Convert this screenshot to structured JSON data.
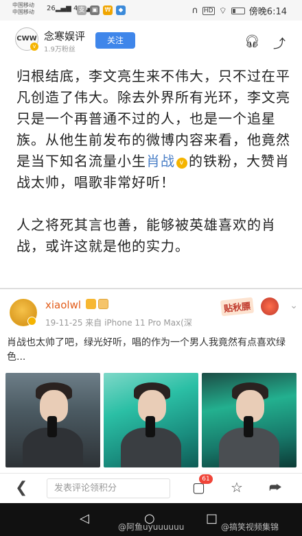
{
  "status_bar": {
    "carrier_1": "中国移动",
    "carrier_2": "中国移动",
    "net_1": "26",
    "net_2": "46",
    "time": "傍晚6:14",
    "hd_label": "HD"
  },
  "account": {
    "avatar_text": "CWW",
    "name": "念寒娱评",
    "fans": "1.9万粉丝",
    "follow_label": "关注",
    "icons": [
      "headphones-icon",
      "share-icon"
    ]
  },
  "article": {
    "para1_part1": "归根结底，李文亮生来不伟大，只不过在平凡创造了伟大。除去外界所有光环，李文亮只是一个再普通不过的人，也是一个追星族。从他生前发布的微博内容来看，他竟然是当下知名流量小生",
    "para1_link": "肖战",
    "para1_part2": "的铁粉，大赞肖战太帅，唱歌非常好听！",
    "para2": "人之将死其言也善，能够被英雄喜欢的肖战，或许这就是他的实力。"
  },
  "embed": {
    "username": "xiaolwl",
    "meta": "19-11-25  来自 iPhone 11 Pro Max(深",
    "sticker_text": "贴秋膘",
    "text": "肖战也太帅了吧，绿光好听，唱的作为一个男人我竟然有点喜欢绿色..."
  },
  "action_bar": {
    "comment_placeholder": "发表评论领积分",
    "comment_count": "61"
  },
  "watermark": {
    "left": "@阿鱼uyuuuuuu",
    "right": "@搞笑视频集锦"
  },
  "colors": {
    "accent": "#3f86ea",
    "link": "#4a7fc7",
    "badge": "#f04438",
    "embed_user": "#e25c19"
  }
}
